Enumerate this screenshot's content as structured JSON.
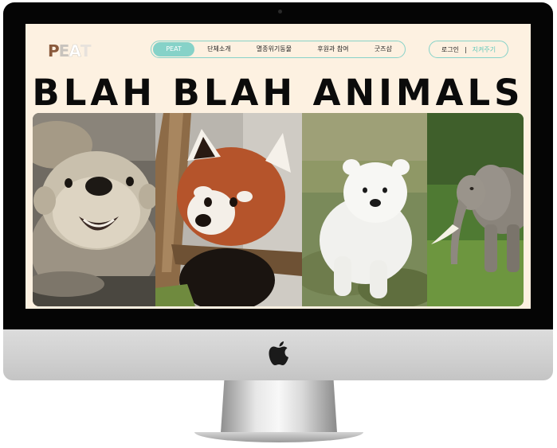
{
  "brand": {
    "logo_letters": [
      "P",
      "E",
      "A",
      "T"
    ],
    "logo_colors": [
      "#8a5a3c",
      "#c8c3bd",
      "#ffffff",
      "#e7e2dc"
    ],
    "accent": "#86d2c8",
    "background": "#fdf1e1"
  },
  "nav": {
    "items": [
      {
        "label": "PEAT",
        "active": true
      },
      {
        "label": "단체소개"
      },
      {
        "label": "멸종위기동물"
      },
      {
        "label": "후원과 참여"
      },
      {
        "label": "굿즈샵"
      }
    ]
  },
  "auth": {
    "login_label": "로그인",
    "separator": "|",
    "protect_label": "지켜주기"
  },
  "hero": {
    "headline": "BLAH BLAH ANIMALS"
  },
  "gallery": {
    "photos": [
      "sea-otter-photo",
      "red-panda-photo",
      "polar-bear-cub-photo",
      "elephant-photo"
    ]
  }
}
